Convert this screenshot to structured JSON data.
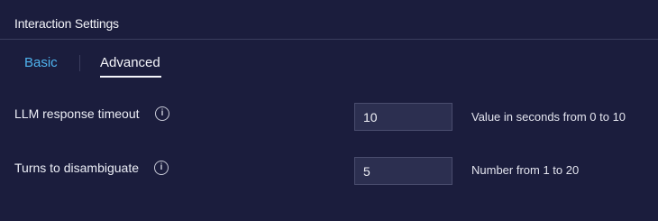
{
  "header": {
    "title": "Interaction Settings"
  },
  "tabs": [
    {
      "label": "Basic",
      "active": false
    },
    {
      "label": "Advanced",
      "active": true
    }
  ],
  "settings": [
    {
      "label": "LLM response timeout",
      "value": "10",
      "hint": "Value in seconds from 0 to 10"
    },
    {
      "label": "Turns to disambiguate",
      "value": "5",
      "hint": "Number from 1 to 20"
    }
  ],
  "icons": {
    "info": "info-icon"
  },
  "colors": {
    "background": "#1b1d3d",
    "accent": "#4fb3ee",
    "field_background": "#2c2f50"
  }
}
